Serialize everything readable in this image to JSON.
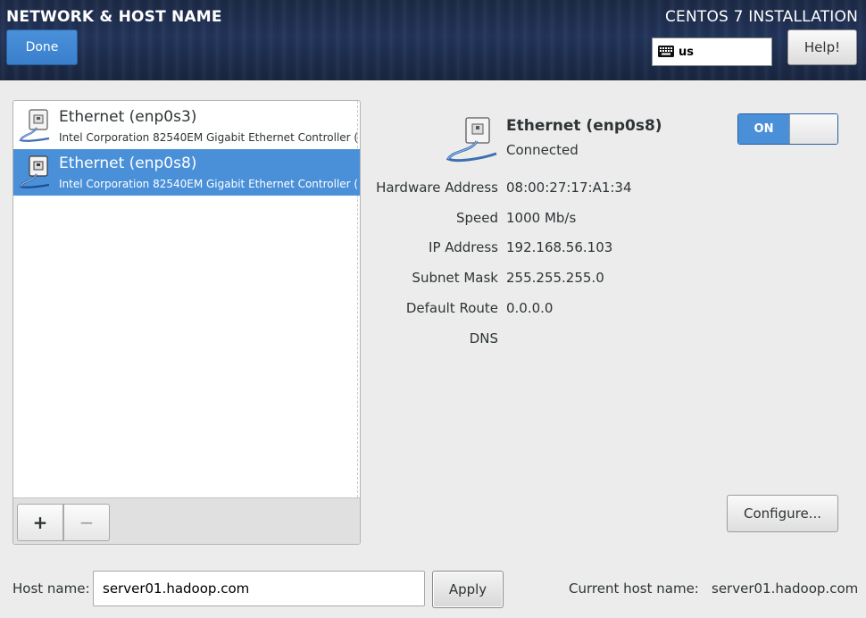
{
  "header": {
    "title": "NETWORK & HOST NAME",
    "done_label": "Done",
    "installer_title": "CENTOS 7 INSTALLATION",
    "keyboard_layout": "us",
    "help_label": "Help!"
  },
  "devices": [
    {
      "name": "Ethernet (enp0s3)",
      "description": "Intel Corporation 82540EM Gigabit Ethernet Controller (",
      "selected": false
    },
    {
      "name": "Ethernet (enp0s8)",
      "description": "Intel Corporation 82540EM Gigabit Ethernet Controller (",
      "selected": true
    }
  ],
  "list_toolbar": {
    "add_label": "+",
    "remove_label": "−"
  },
  "detail": {
    "name": "Ethernet (enp0s8)",
    "status": "Connected",
    "toggle_label": "ON",
    "toggle_state": "on",
    "properties": [
      {
        "label": "Hardware Address",
        "value": "08:00:27:17:A1:34"
      },
      {
        "label": "Speed",
        "value": "1000 Mb/s"
      },
      {
        "label": "IP Address",
        "value": "192.168.56.103"
      },
      {
        "label": "Subnet Mask",
        "value": "255.255.255.0"
      },
      {
        "label": "Default Route",
        "value": "0.0.0.0"
      },
      {
        "label": "DNS",
        "value": ""
      }
    ],
    "configure_label": "Configure..."
  },
  "hostname": {
    "label": "Host name:",
    "value": "server01.hadoop.com",
    "apply_label": "Apply",
    "current_label": "Current host name:",
    "current_value": "server01.hadoop.com"
  },
  "colors": {
    "accent": "#4a90d9",
    "header_bg": "#1d2a46",
    "window_bg": "#ececec"
  },
  "icons": {
    "device": "ethernet-cable-icon",
    "keyboard": "keyboard-icon"
  }
}
